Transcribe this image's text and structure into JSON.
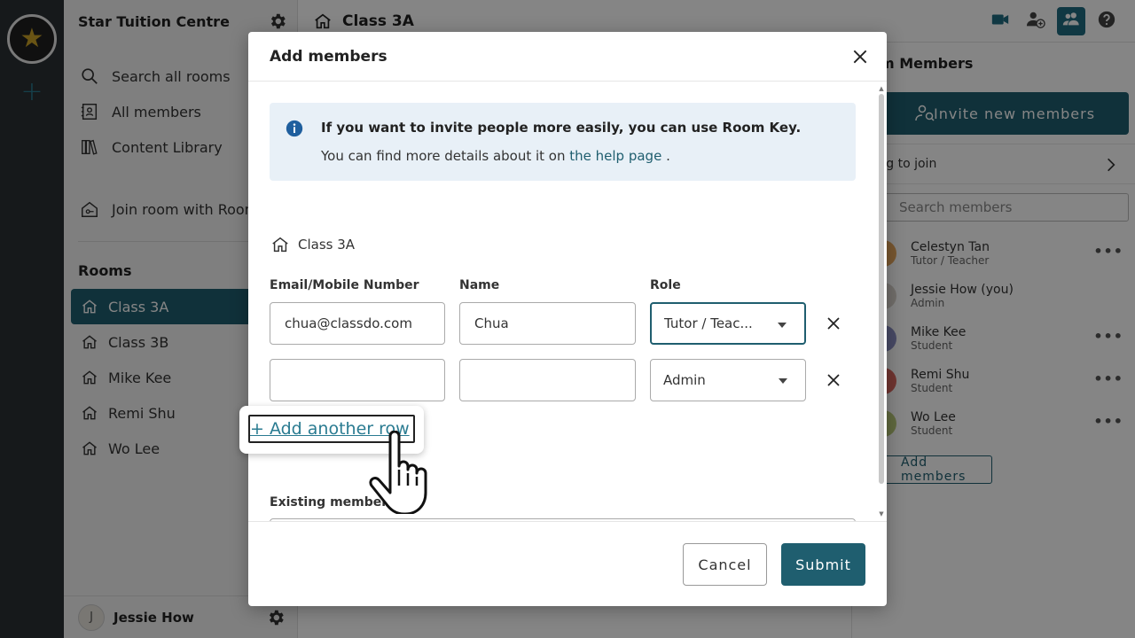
{
  "app": {
    "org_name": "Star Tuition Centre",
    "current_room": "Class 3A"
  },
  "sidebar": {
    "nav": [
      {
        "label": "Search all rooms",
        "icon": "search-icon"
      },
      {
        "label": "All members",
        "icon": "members-book-icon"
      },
      {
        "label": "Content Library",
        "icon": "library-icon"
      }
    ],
    "join_label": "Join room with Room",
    "rooms_heading": "Rooms",
    "rooms": [
      "Class 3A",
      "Class 3B",
      "Mike Kee",
      "Remi Shu",
      "Wo Lee"
    ],
    "user_initial": "J",
    "user_name": "Jessie How"
  },
  "right_panel": {
    "title": "om Members",
    "invite_label": "Invite new members",
    "waiting_label": "ting to join",
    "search_placeholder": "Search members",
    "members": [
      {
        "name": "Celestyn Tan",
        "role": "Tutor / Teacher",
        "color": "#e6a85c"
      },
      {
        "name": "Jessie How (you)",
        "role": "Admin",
        "color": "#d8d4cc"
      },
      {
        "name": "Mike Kee",
        "role": "Student",
        "color": "#8a8fc4"
      },
      {
        "name": "Remi Shu",
        "role": "Student",
        "color": "#d9675e"
      },
      {
        "name": "Wo Lee",
        "role": "Student",
        "color": "#b9c97a"
      }
    ],
    "add_members_label": "Add members"
  },
  "modal": {
    "title": "Add members",
    "info_title": "If you want to invite people more easily, you can use Room Key.",
    "info_text_prefix": "You can find more details about it on ",
    "info_link": "the help page",
    "info_text_suffix": " .",
    "room_name": "Class 3A",
    "columns": {
      "email": "Email/Mobile Number",
      "name": "Name",
      "role": "Role"
    },
    "rows": [
      {
        "email": "chua@classdo.com",
        "name": "Chua",
        "role": "Tutor / Teac..."
      },
      {
        "email": "",
        "name": "",
        "role": "Admin"
      }
    ],
    "add_row_label": "+ Add another row",
    "existing_label": "Existing members",
    "existing_value": "",
    "cancel_label": "Cancel",
    "submit_label": "Submit"
  },
  "colors": {
    "accent": "#1f5e6f",
    "link": "#2a7b91",
    "info_bg": "#e8f0f7",
    "rail": "#2b3034",
    "star": "#c9a227"
  }
}
